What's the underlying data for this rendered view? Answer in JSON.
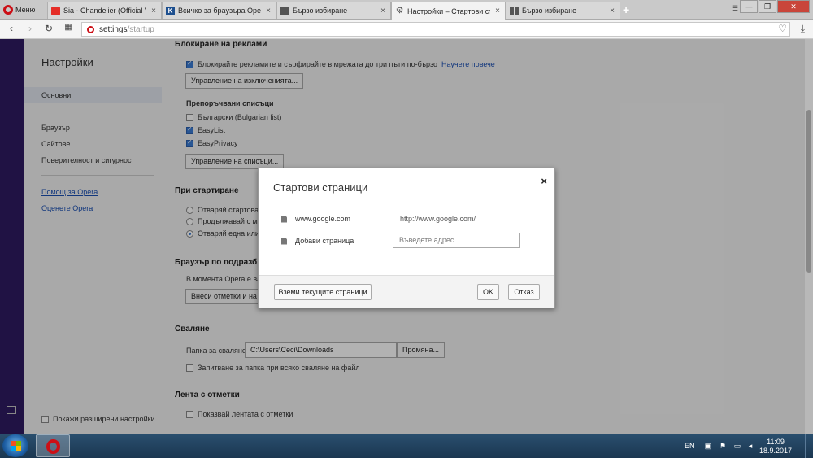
{
  "tabs": {
    "menu_label": "Меню",
    "items": [
      {
        "label": "Sia - Chandelier (Official V",
        "close": "×"
      },
      {
        "label": "Всичко за браузъра Opera",
        "close": "×"
      },
      {
        "label": "Бързо избиране",
        "close": "×"
      },
      {
        "label": "Настройки – Стартови стр",
        "close": "×"
      },
      {
        "label": "Бързо избиране",
        "close": "×"
      }
    ],
    "new_tab": "+"
  },
  "address_bar": {
    "url_host": "settings",
    "url_path": "/startup"
  },
  "settings_nav": {
    "title": "Настройки",
    "items": [
      "Основни",
      "Браузър",
      "Сайтове",
      "Поверителност и сигурност"
    ],
    "links": [
      "Помощ за Opera",
      "Оценете Opera"
    ],
    "advanced_label": "Покажи разширени настройки"
  },
  "settings": {
    "ads_title": "Блокиране на реклами",
    "ads_block_text": "Блокирайте рекламите и сърфирайте в мрежата до три пъти по-бързо",
    "ads_learn_more": "Научете повече",
    "exceptions_button": "Управление на изключенията...",
    "lists_title": "Препоръчвани списъци",
    "lists": [
      {
        "label": "Български (Bulgarian list)",
        "checked": false
      },
      {
        "label": "EasyList",
        "checked": true
      },
      {
        "label": "EasyPrivacy",
        "checked": true
      }
    ],
    "lists_button": "Управление на списъци...",
    "startup_title": "При стартиране",
    "startup_options": [
      "Отваряй стартоват",
      "Продължавай с ми",
      "Отваряй една или"
    ],
    "default_browser_title": "Браузър по подразб",
    "default_browser_text": "В момента Opera е ва",
    "import_button": "Внеси отметки и на",
    "download_title": "Сваляне",
    "download_folder_label": "Папка за сваляне:",
    "download_folder_value": "C:\\Users\\Ceci\\Downloads",
    "download_change_button": "Промяна...",
    "download_ask_label": "Запитване за папка при всяко сваляне на файл",
    "bookmarks_title": "Лента с отметки",
    "bookmarks_show_label": "Показвай лентата с отметки"
  },
  "dialog": {
    "title": "Стартови страници",
    "close": "×",
    "page_name": "www.google.com",
    "page_url": "http://www.google.com/",
    "add_page_label": "Добави страница",
    "add_page_placeholder": "Въведете адрес...",
    "use_current_button": "Вземи текущите страници",
    "ok_button": "OK",
    "cancel_button": "Отказ"
  },
  "taskbar": {
    "language": "EN",
    "time": "11:09",
    "date": "18.9.2017 г."
  }
}
